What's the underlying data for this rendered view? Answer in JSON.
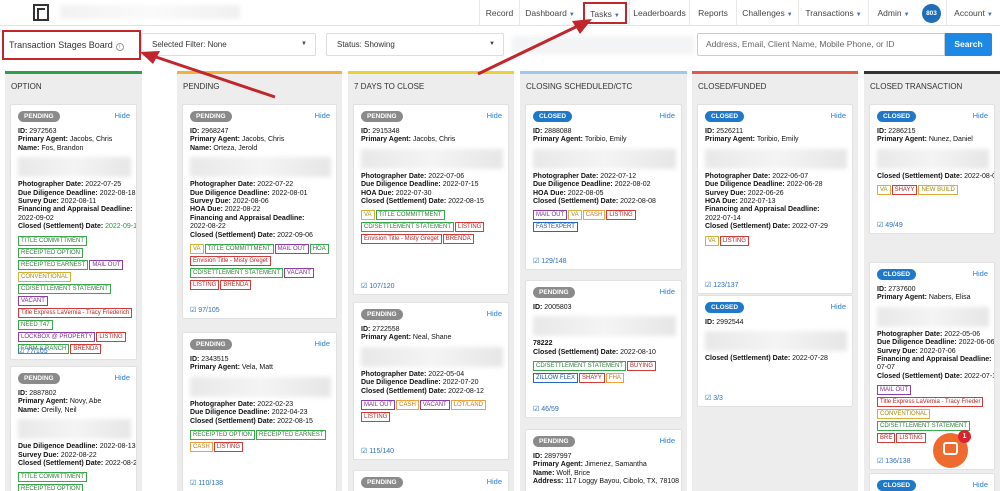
{
  "nav": {
    "items": [
      {
        "label": "Record",
        "caret": false
      },
      {
        "label": "Dashboard",
        "caret": true
      },
      {
        "label": "Tasks",
        "caret": true
      },
      {
        "label": "Leaderboards",
        "caret": false
      },
      {
        "label": "Reports",
        "caret": false
      },
      {
        "label": "Challenges",
        "caret": true
      },
      {
        "label": "Transactions",
        "caret": true
      },
      {
        "label": "Admin",
        "caret": true
      }
    ],
    "avatar": "803",
    "account": "Account"
  },
  "filter": {
    "title": "Transaction Stages Board",
    "selected_filter": "Selected Filter: None",
    "status": "Status: Showing",
    "search_placeholder": "Address, Email, Client Name, Mobile Phone, or ID",
    "search_button": "Search"
  },
  "labels": {
    "hide": "Hide"
  },
  "columns": [
    {
      "title": "OPTION",
      "color": "#2e9e4a"
    },
    {
      "title": "PENDING",
      "color": "#f0b23a"
    },
    {
      "title": "7 DAYS TO CLOSE",
      "color": "#e8d23a"
    },
    {
      "title": "CLOSING SCHEDULED/CTC",
      "color": "#9fc9ea"
    },
    {
      "title": "CLOSED/FUNDED",
      "color": "#e05a4a"
    },
    {
      "title": "CLOSED TRANSACTION",
      "color": "#333333"
    }
  ],
  "cards": [
    {
      "status": "PENDING",
      "lines": [
        "ID: 2972563",
        "Primary Agent: Jacobs, Chris",
        "Name: Fos, Brandon"
      ],
      "dates": [
        [
          "Photographer Date:",
          "2022-07-25",
          ""
        ],
        [
          "Due Diligence Deadline:",
          "2022-08-18",
          ""
        ],
        [
          "Survey Due:",
          "2022-08-11",
          ""
        ],
        [
          "Financing and Appraisal Deadline:",
          "",
          ""
        ],
        [
          "",
          "2022-09-02",
          ""
        ],
        [
          "Closed (Settlement) Date:",
          "2022-09-15",
          "green"
        ]
      ],
      "tags": [
        [
          "TITLE COMMITTMENT",
          "t-green"
        ],
        [
          "RECEIPTED OPTION",
          "t-green"
        ],
        [
          "RECEIPTED EARNEST",
          "t-green"
        ],
        [
          "MAIL OUT",
          "t-purple"
        ],
        [
          "CONVENTIONAL",
          "t-gold"
        ],
        [
          "CD/SETTLEMENT STATEMENT",
          "t-green"
        ],
        [
          "VACANT",
          "t-purple"
        ],
        [
          "Title Express LaVernia - Tracy Friederich",
          "t-red"
        ],
        [
          "NEED T47",
          "t-green"
        ],
        [
          "LOCKBOX @ PROPERTY",
          "t-purple"
        ],
        [
          "LISTING",
          "t-red"
        ],
        [
          "FARM & RANCH",
          "t-green"
        ],
        [
          "BRENDA",
          "t-red"
        ]
      ],
      "count": "77/105"
    },
    {
      "status": "PENDING",
      "lines": [
        "ID: 2887802",
        "Primary Agent: Novy, Abe",
        "Name: Oreilly, Neil"
      ],
      "dates": [
        [
          "Due Diligence Deadline:",
          "2022-08-13",
          ""
        ],
        [
          "Survey Due:",
          "2022-08-22",
          ""
        ],
        [
          "Closed (Settlement) Date:",
          "2022-08-29",
          ""
        ]
      ],
      "tags": [
        [
          "TITLE COMMITTMENT",
          "t-green"
        ],
        [
          "RECEIPTED OPTION",
          "t-green"
        ],
        [
          "RECEIPTED EARNEST",
          "t-green"
        ]
      ],
      "count": ""
    },
    {
      "status": "PENDING",
      "lines": [
        "ID: 2968247",
        "Primary Agent: Jacobs, Chris",
        "Name: Orteza, Jerold"
      ],
      "dates": [
        [
          "Photographer Date:",
          "2022-07-22",
          ""
        ],
        [
          "Due Diligence Deadline:",
          "2022-08-01",
          ""
        ],
        [
          "Survey Due:",
          "2022-08-06",
          ""
        ],
        [
          "HOA Due:",
          "2022-08-22",
          ""
        ],
        [
          "Financing and Appraisal Deadline:",
          "",
          ""
        ],
        [
          "",
          "2022-08-22",
          ""
        ],
        [
          "Closed (Settlement) Date:",
          "2022-09-06",
          ""
        ]
      ],
      "tags": [
        [
          "VA",
          "t-gold"
        ],
        [
          "TITLE COMMITTMENT",
          "t-green"
        ],
        [
          "MAIL OUT",
          "t-purple"
        ],
        [
          "HOA",
          "t-green"
        ],
        [
          "Envision Title - Misty Greget",
          "t-red"
        ],
        [
          "CD/SETTLEMENT STATEMENT",
          "t-green"
        ],
        [
          "VACANT",
          "t-purple"
        ],
        [
          "LISTING",
          "t-red"
        ],
        [
          "BRENDA",
          "t-red"
        ]
      ],
      "count": "97/105"
    },
    {
      "status": "PENDING",
      "lines": [
        "ID: 2343515",
        "Primary Agent: Vela, Matt"
      ],
      "dates": [
        [
          "Photographer Date:",
          "2022-02-23",
          ""
        ],
        [
          "Due Diligence Deadline:",
          "2022-04-23",
          ""
        ],
        [
          "Closed (Settlement) Date:",
          "2022-08-15",
          ""
        ]
      ],
      "tags": [
        [
          "RECEIPTED OPTION",
          "t-green"
        ],
        [
          "RECEIPTED EARNEST",
          "t-green"
        ],
        [
          "CASH",
          "t-orange"
        ],
        [
          "LISTING",
          "t-red"
        ]
      ],
      "count": "110/138"
    },
    {
      "status": "PENDING",
      "lines": [
        "ID: 2915348",
        "Primary Agent: Jacobs, Chris"
      ],
      "dates": [
        [
          "Photographer Date:",
          "2022-07-06",
          ""
        ],
        [
          "Due Diligence Deadline:",
          "2022-07-15",
          ""
        ],
        [
          "HOA Due:",
          "2022-07-30",
          ""
        ],
        [
          "Closed (Settlement) Date:",
          "2022-08-15",
          ""
        ]
      ],
      "tags": [
        [
          "VA",
          "t-gold"
        ],
        [
          "TITLE COMMITTMENT",
          "t-green"
        ],
        [
          "CD/SETTLEMENT STATEMENT",
          "t-green"
        ],
        [
          "LISTING",
          "t-red"
        ],
        [
          "Envision Title - Misty Greget",
          "t-red"
        ],
        [
          "BRENDA",
          "t-red"
        ]
      ],
      "count": "107/120"
    },
    {
      "status": "PENDING",
      "lines": [
        "ID: 2722558",
        "Primary Agent: Neal, Shane"
      ],
      "dates": [
        [
          "Photographer Date:",
          "2022-05-04",
          ""
        ],
        [
          "Due Diligence Deadline:",
          "2022-07-20",
          ""
        ],
        [
          "Closed (Settlement) Date:",
          "2022-08-12",
          ""
        ]
      ],
      "tags": [
        [
          "MAIL OUT",
          "t-purple"
        ],
        [
          "CASH",
          "t-orange"
        ],
        [
          "VACANT",
          "t-purple"
        ],
        [
          "LOT/LAND",
          "t-orange"
        ],
        [
          "LISTING",
          "t-red"
        ]
      ],
      "count": "115/140"
    },
    {
      "status": "PENDING",
      "lines": [],
      "dates": [],
      "tags": [],
      "count": ""
    },
    {
      "status": "CLOSED",
      "lines": [
        "ID: 2888088",
        "Primary Agent: Toribio, Emily"
      ],
      "dates": [
        [
          "Photographer Date:",
          "2022-07-12",
          ""
        ],
        [
          "Due Diligence Deadline:",
          "2022-08-02",
          ""
        ],
        [
          "HOA Due:",
          "2022-08-05",
          ""
        ],
        [
          "Closed (Settlement) Date:",
          "2022-08-08",
          ""
        ]
      ],
      "tags": [
        [
          "MAIL OUT",
          "t-purple"
        ],
        [
          "VA",
          "t-gold"
        ],
        [
          "CASH",
          "t-orange"
        ],
        [
          "LISTING",
          "t-red"
        ],
        [
          "FASTEXPERT",
          "t-blue"
        ]
      ],
      "count": "129/148"
    },
    {
      "status": "PENDING",
      "lines": [
        "ID: 2005803"
      ],
      "dates": [
        [
          "78222",
          "",
          ""
        ],
        [
          "Closed (Settlement) Date:",
          "2022-08-10",
          ""
        ]
      ],
      "tags": [
        [
          "CD/SETTLEMENT STATEMENT",
          "t-green"
        ],
        [
          "BUYING",
          "t-red"
        ],
        [
          "ZILLOW FLEX",
          "t-blue"
        ],
        [
          "SHAYY",
          "t-red"
        ],
        [
          "FHA",
          "t-orange"
        ]
      ],
      "count": "46/59"
    },
    {
      "status": "PENDING",
      "lines": [
        "ID: 2897997",
        "Primary Agent: Jimenez, Samantha",
        "Name: Wolf, Brice",
        "Address: 117 Loggy Bayou, Cibolo, TX, 78108"
      ],
      "dates": [],
      "tags": [],
      "count": ""
    },
    {
      "status": "CLOSED",
      "lines": [
        "ID: 2526211",
        "Primary Agent: Toribio, Emily"
      ],
      "dates": [
        [
          "Photographer Date:",
          "2022-06-07",
          ""
        ],
        [
          "Due Diligence Deadline:",
          "2022-06-28",
          ""
        ],
        [
          "Survey Due:",
          "2022-06-26",
          ""
        ],
        [
          "HOA Due:",
          "2022-07-13",
          ""
        ],
        [
          "Financing and Appraisal Deadline:",
          "",
          ""
        ],
        [
          "",
          "2022-07-14",
          ""
        ],
        [
          "Closed (Settlement) Date:",
          "2022-07-29",
          ""
        ]
      ],
      "tags": [
        [
          "VA",
          "t-gold"
        ],
        [
          "LISTING",
          "t-red"
        ]
      ],
      "count": "123/137"
    },
    {
      "status": "CLOSED",
      "lines": [
        "ID: 2992544"
      ],
      "dates": [
        [
          "Closed (Settlement) Date:",
          "2022-07-28",
          ""
        ]
      ],
      "tags": [],
      "count": "3/3"
    },
    {
      "status": "CLOSED",
      "lines": [
        "ID: 2286215",
        "Primary Agent: Nunez, Daniel"
      ],
      "dates": [
        [
          "Closed (Settlement) Date:",
          "2022-08-08",
          ""
        ]
      ],
      "tags": [
        [
          "VA",
          "t-gold"
        ],
        [
          "SHAYY",
          "t-red"
        ],
        [
          "NEW BUILD",
          "t-gold"
        ]
      ],
      "count": "49/49"
    },
    {
      "status": "CLOSED",
      "lines": [
        "ID: 2737600",
        "Primary Agent: Nabers, Elisa"
      ],
      "dates": [
        [
          "Photographer Date:",
          "2022-05-06",
          ""
        ],
        [
          "Due Diligence Deadline:",
          "2022-06-06",
          ""
        ],
        [
          "Survey Due:",
          "2022-07-06",
          ""
        ],
        [
          "Financing and Appraisal Deadline:",
          "",
          ""
        ],
        [
          "",
          "07-07",
          ""
        ],
        [
          "Closed (Settlement) Date:",
          "2022-07-1",
          ""
        ]
      ],
      "tags": [
        [
          "MAIL OUT",
          "t-purple"
        ],
        [
          "Title Express LaVernia - Tracy Frieder",
          "t-red"
        ],
        [
          "CONVENTIONAL",
          "t-gold"
        ],
        [
          "CD/SETTLEMENT STATEMENT",
          "t-green"
        ],
        [
          "BRE",
          "t-red"
        ],
        [
          "LISTING",
          "t-red"
        ]
      ],
      "count": "136/138"
    },
    {
      "status": "CLOSED",
      "lines": [],
      "dates": [],
      "tags": [],
      "count": ""
    }
  ],
  "chat": {
    "badge": "1"
  }
}
